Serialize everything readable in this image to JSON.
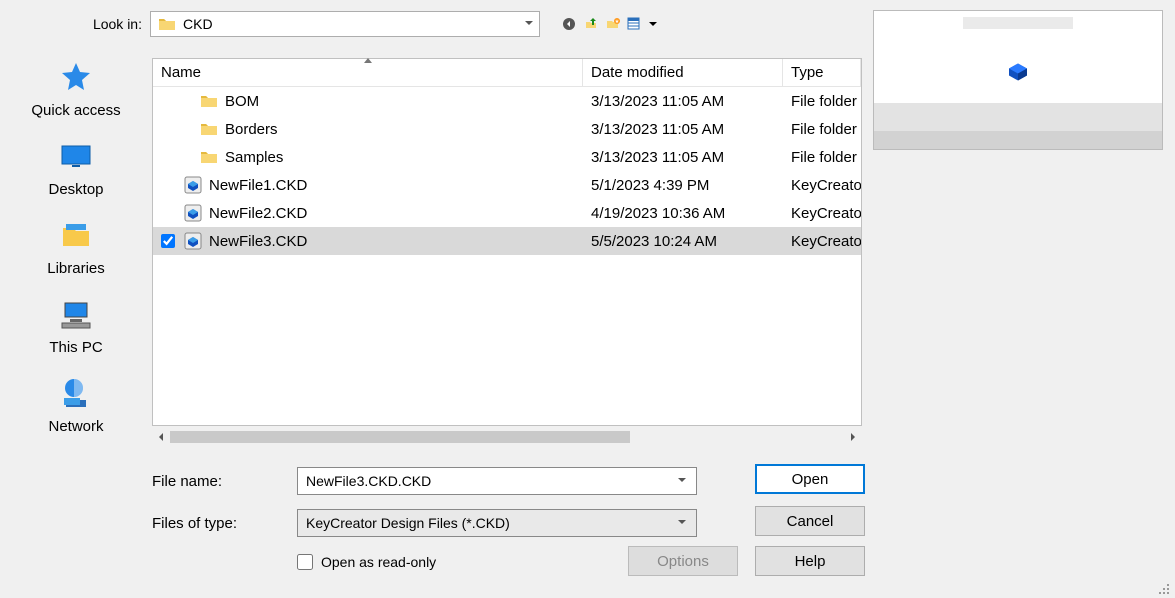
{
  "lookin_label": "Look in:",
  "lookin_value": "CKD",
  "columns": {
    "name": "Name",
    "date": "Date modified",
    "type": "Type"
  },
  "files": [
    {
      "icon": "folder",
      "name": "BOM",
      "date": "3/13/2023 11:05 AM",
      "type": "File folder",
      "selected": false
    },
    {
      "icon": "folder",
      "name": "Borders",
      "date": "3/13/2023 11:05 AM",
      "type": "File folder",
      "selected": false
    },
    {
      "icon": "folder",
      "name": "Samples",
      "date": "3/13/2023 11:05 AM",
      "type": "File folder",
      "selected": false
    },
    {
      "icon": "ckd",
      "name": "NewFile1.CKD",
      "date": "5/1/2023 4:39 PM",
      "type": "KeyCreator Design File",
      "selected": false
    },
    {
      "icon": "ckd",
      "name": "NewFile2.CKD",
      "date": "4/19/2023 10:36 AM",
      "type": "KeyCreator Design File",
      "selected": false
    },
    {
      "icon": "ckd",
      "name": "NewFile3.CKD",
      "date": "5/5/2023 10:24 AM",
      "type": "KeyCreator Design File",
      "selected": true
    }
  ],
  "sidebar": {
    "items": [
      {
        "label": "Quick access"
      },
      {
        "label": "Desktop"
      },
      {
        "label": "Libraries"
      },
      {
        "label": "This PC"
      },
      {
        "label": "Network"
      }
    ]
  },
  "filename_label": "File name:",
  "filename_value": "NewFile3.CKD.CKD",
  "filetype_label": "Files of type:",
  "filetype_value": "KeyCreator Design Files (*.CKD)",
  "readonly_label": "Open as read-only",
  "buttons": {
    "open": "Open",
    "cancel": "Cancel",
    "options": "Options",
    "help": "Help"
  }
}
